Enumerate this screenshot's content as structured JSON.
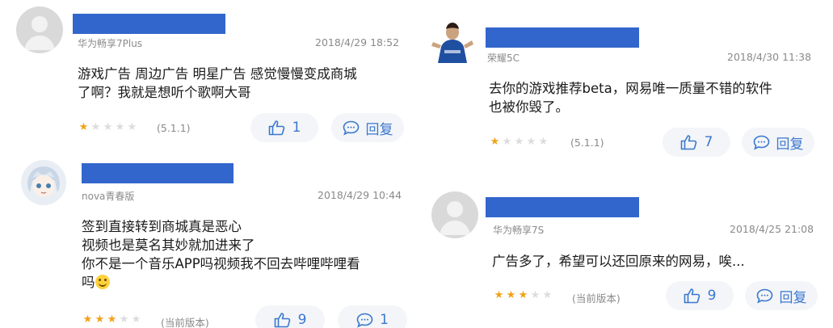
{
  "theme": {
    "accent": "#3b78cf",
    "redaction": "#3366cc",
    "star_on": "#f0a218",
    "star_off": "#dcdcdc",
    "pill_bg": "#f3f5f8",
    "muted": "#8a8a8a"
  },
  "reviews": [
    {
      "avatar": "default-avatar-icon",
      "device": "华为畅享7Plus",
      "time": "2018/4/29 18:52",
      "lines": [
        "游戏广告 周边广告 明星广告 感觉慢慢变成商城",
        "了啊？我就是想听个歌啊大哥"
      ],
      "rating": 1,
      "version": "(5.1.1)",
      "likes": "1",
      "reply_label": "回复"
    },
    {
      "avatar": "anime-avatar-icon",
      "device": "nova青春版",
      "time": "2018/4/29 10:44",
      "lines": [
        "签到直接转到商城真是恶心",
        "视频也是莫名其妙就加进来了",
        "你不是一个音乐APP吗视频我不回去哔哩哔哩看",
        "吗"
      ],
      "rating": 3,
      "version": "(当前版本)",
      "likes": "9",
      "reply_count": "1"
    },
    {
      "avatar": "soccer-player-avatar-icon",
      "device": "荣耀5C",
      "time": "2018/4/30 11:38",
      "lines": [
        "去你的游戏推荐beta，网易唯一质量不错的软件",
        "也被你毁了。"
      ],
      "rating": 1,
      "version": "(5.1.1)",
      "likes": "7",
      "reply_label": "回复"
    },
    {
      "avatar": "default-avatar-icon",
      "device": "华为畅享7S",
      "time": "2018/4/25 21:08",
      "lines": [
        "广告多了，希望可以还回原来的网易，唉..."
      ],
      "rating": 3,
      "version": "(当前版本)",
      "likes": "9",
      "reply_label": "回复"
    }
  ]
}
